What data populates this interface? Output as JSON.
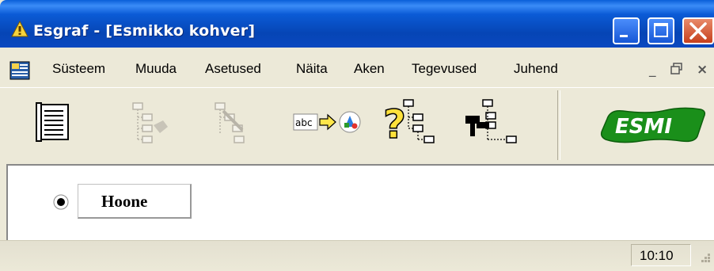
{
  "window": {
    "title": "Esgraf - [Esmikko kohver]"
  },
  "menu": {
    "items": [
      "Süsteem",
      "Muuda",
      "Asetused",
      "Näita",
      "Aken",
      "Tegevused",
      "Juhend"
    ],
    "mdi_min": "_",
    "mdi_restore": "🗗",
    "mdi_close": "×"
  },
  "toolbar": {
    "icons": [
      "document-list-icon",
      "tree-add-icon",
      "tree-delete-icon",
      "text-to-graphic-icon",
      "tree-help-icon",
      "tree-link-icon"
    ],
    "text_icon_label": "abc",
    "logo_text": "ESMI"
  },
  "canvas": {
    "node_label": "Hoone"
  },
  "status": {
    "time": "10:10"
  },
  "colors": {
    "titlebar": "#0a48c0",
    "close_button": "#c7401c",
    "logo_green": "#1a8f1a"
  }
}
